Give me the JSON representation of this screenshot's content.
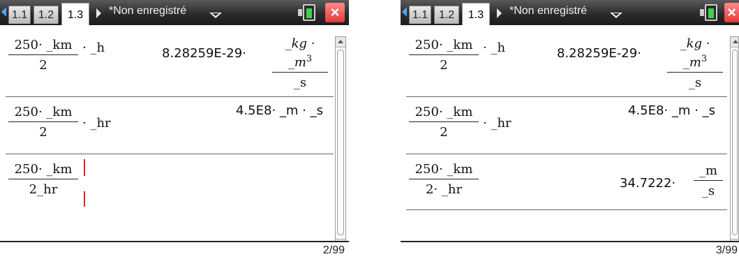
{
  "left": {
    "tabs": [
      "1.1",
      "1.2",
      "1.3"
    ],
    "active_tab": "1.3",
    "doc_title": "*Non enregistré",
    "entries": [
      {
        "input_num": "250· _km",
        "input_den": "2",
        "input_tail": "· _h",
        "result_coef": "8.28259E-29·",
        "result_num": "_kg · _m",
        "result_exp": "3",
        "result_den": "_s"
      },
      {
        "input_num": "250· _km",
        "input_den": "2",
        "input_tail": "· _hr",
        "result": "4.5E8· _m · _s"
      },
      {
        "input_num": "250· _km",
        "input_den": "2_hr"
      }
    ],
    "page_count": "2/99"
  },
  "right": {
    "tabs": [
      "1.1",
      "1.2",
      "1.3"
    ],
    "active_tab": "1.3",
    "doc_title": "*Non enregistré",
    "entries": [
      {
        "input_num": "250· _km",
        "input_den": "2",
        "input_tail": "· _h",
        "result_coef": "8.28259E-29·",
        "result_num": "_kg · _m",
        "result_exp": "3",
        "result_den": "_s"
      },
      {
        "input_num": "250· _km",
        "input_den": "2",
        "input_tail": "· _hr",
        "result": "4.5E8· _m · _s"
      },
      {
        "input_num": "250· _km",
        "input_den": "2· _hr",
        "result_coef": "34.7222·",
        "result_num": "_m",
        "result_den": "_s"
      }
    ],
    "page_count": "3/99"
  },
  "colors": {
    "titlebar": "#2b2b2b",
    "accent_arrow": "#4da3ff",
    "close": "#e23b3b",
    "battery": "#3fd34a",
    "cursor": "#d9272e"
  },
  "icons": [
    "left-arrow-icon",
    "right-arrow-icon",
    "dropdown-icon",
    "battery-icon",
    "close-icon",
    "scroll-up-icon",
    "scroll-down-icon"
  ]
}
